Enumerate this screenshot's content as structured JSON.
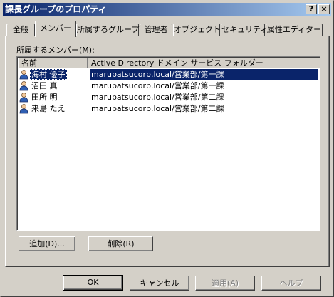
{
  "window": {
    "title": "課長グループのプロパティ",
    "help_glyph": "?",
    "close_glyph": "×"
  },
  "tabs": [
    {
      "label": "全般",
      "active": false
    },
    {
      "label": "メンバー",
      "active": true
    },
    {
      "label": "所属するグループ",
      "active": false
    },
    {
      "label": "管理者",
      "active": false
    },
    {
      "label": "オブジェクト",
      "active": false
    },
    {
      "label": "セキュリティ",
      "active": false
    },
    {
      "label": "属性エディター",
      "active": false
    }
  ],
  "members": {
    "label": "所属するメンバー(M):",
    "columns": [
      "名前",
      "Active Directory ドメイン サービス フォルダー"
    ],
    "rows": [
      {
        "name": "海村 優子",
        "folder": "marubatsucorp.local/営業部/第一課",
        "icon": "user-icon",
        "selected": true
      },
      {
        "name": "沼田 真",
        "folder": "marubatsucorp.local/営業部/第一課",
        "icon": "user-icon",
        "selected": false
      },
      {
        "name": "田所 明",
        "folder": "marubatsucorp.local/営業部/第二課",
        "icon": "user-icon",
        "selected": false
      },
      {
        "name": "来島 たえ",
        "folder": "marubatsucorp.local/営業部/第二課",
        "icon": "user-icon",
        "selected": false
      }
    ],
    "add_label": "追加(D)...",
    "remove_label": "削除(R)"
  },
  "footer": {
    "ok_label": "OK",
    "cancel_label": "キャンセル",
    "apply_label": "適用(A)",
    "help_label": "ヘルプ"
  },
  "colors": {
    "title_start": "#0a246a",
    "title_end": "#a6caf0",
    "selection": "#0a246a",
    "face": "#d4d0c8"
  }
}
